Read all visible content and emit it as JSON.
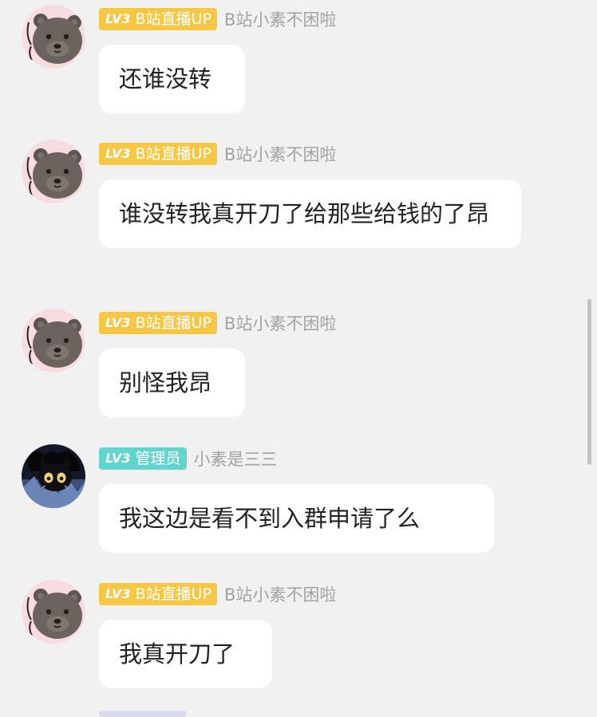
{
  "messages": [
    {
      "avatar": "bear-avatar",
      "level": "LV3",
      "badge_text": "B站直播UP",
      "badge_kind": "up",
      "username": "B站小素不困啦",
      "text": "还谁没转"
    },
    {
      "avatar": "bear-avatar",
      "level": "LV3",
      "badge_text": "B站直播UP",
      "badge_kind": "up",
      "username": "B站小素不困啦",
      "text": "谁没转我真开刀了给那些给钱的了昂"
    },
    {
      "avatar": "bear-avatar",
      "level": "LV3",
      "badge_text": "B站直播UP",
      "badge_kind": "up",
      "username": "B站小素不困啦",
      "text": "别怪我昂"
    },
    {
      "avatar": "cat-avatar",
      "level": "LV3",
      "badge_text": "管理员",
      "badge_kind": "admin",
      "username": "小素是三三",
      "text": "我这边是看不到入群申请了么"
    },
    {
      "avatar": "bear-avatar",
      "level": "LV3",
      "badge_text": "B站直播UP",
      "badge_kind": "up",
      "username": "B站小素不困啦",
      "text": "我真开刀了"
    }
  ],
  "colors": {
    "background": "#f1f1f1",
    "bubble": "#ffffff",
    "badge_up": "#f5c744",
    "badge_admin": "#5fd5cb",
    "username": "#a3a3a3",
    "text": "#222222"
  }
}
